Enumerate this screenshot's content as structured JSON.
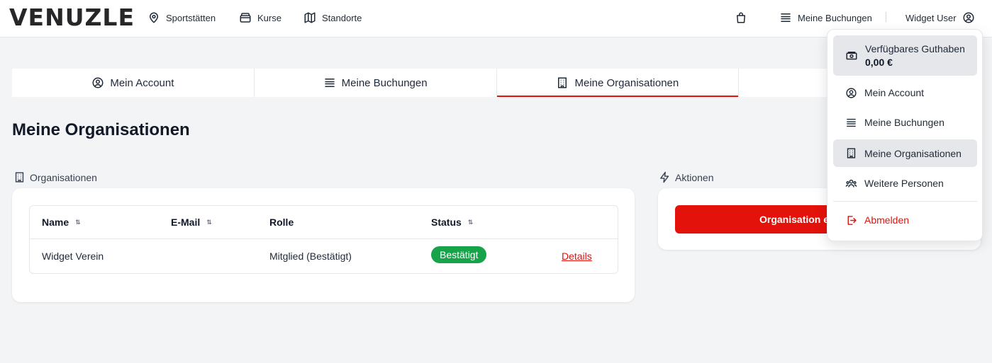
{
  "brand": {
    "logo": "VENUZLE",
    "accent": "#e3120b",
    "success": "#16a34a"
  },
  "nav": {
    "items": [
      {
        "label": "Sportstätten",
        "icon": "map-pin-icon"
      },
      {
        "label": "Kurse",
        "icon": "wallet-icon"
      },
      {
        "label": "Standorte",
        "icon": "map-icon"
      }
    ],
    "cart_icon": "shopping-bag-icon",
    "bookings_label": "Meine Buchungen",
    "user_label": "Widget User"
  },
  "tabs": [
    {
      "label": "Mein Account",
      "icon": "user-circle-icon"
    },
    {
      "label": "Meine Buchungen",
      "icon": "list-icon"
    },
    {
      "label": "Meine Organisationen",
      "icon": "building-icon",
      "active": true
    },
    {
      "label": "",
      "icon": "users-icon"
    }
  ],
  "page": {
    "title": "Meine Organisationen"
  },
  "organisations": {
    "section_label": "Organisationen",
    "columns": [
      {
        "label": "Name",
        "sortable": true
      },
      {
        "label": "E-Mail",
        "sortable": true
      },
      {
        "label": "Rolle",
        "sortable": false
      },
      {
        "label": "Status",
        "sortable": true
      }
    ],
    "rows": [
      {
        "name": "Widget Verein",
        "email": "",
        "role": "Mitglied (Bestätigt)",
        "status": "Bestätigt",
        "action": "Details"
      }
    ]
  },
  "actions": {
    "section_label": "Aktionen",
    "primary_button": "Organisation e"
  },
  "dropdown": {
    "credit_label": "Verfügbares Guthaben",
    "credit_value": "0,00 €",
    "items": [
      {
        "label": "Mein Account"
      },
      {
        "label": "Meine Buchungen"
      },
      {
        "label": "Meine Organisationen",
        "highlighted": true
      },
      {
        "label": "Weitere Personen"
      }
    ],
    "logout_label": "Abmelden"
  }
}
